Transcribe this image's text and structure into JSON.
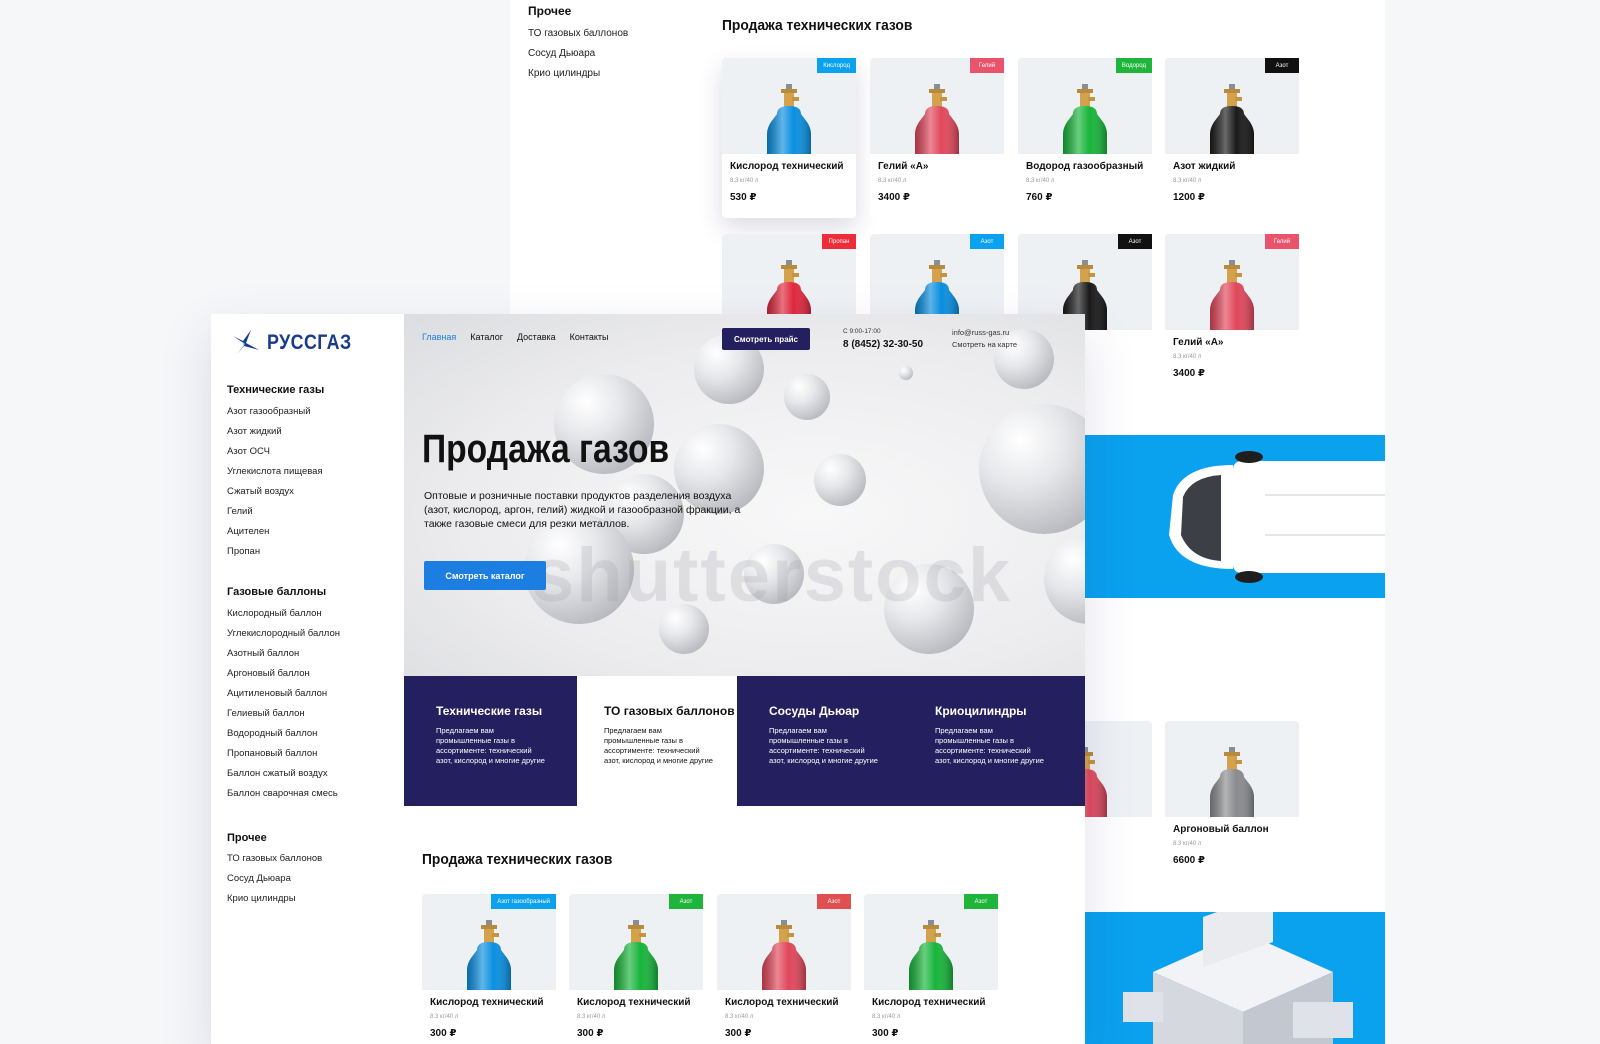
{
  "back": {
    "sidebar": {
      "other_title": "Прочее",
      "other_items": [
        "ТО газовых баллонов",
        "Сосуд Дьюара",
        "Крио цилиндры"
      ]
    },
    "section_title": "Продажа технических газов",
    "products_row1": [
      {
        "tag": "Кислород",
        "tag_color": "#0aa1ef",
        "cyl_color": "#0a8fe0",
        "name": "Кислород технический",
        "spec": "8.3 кг/40 л",
        "price": "530 ₽"
      },
      {
        "tag": "Гелий",
        "tag_color": "#e9546c",
        "cyl_color": "#e0475b",
        "name": "Гелий «А»",
        "spec": "8.3 кг/40 л",
        "price": "3400 ₽"
      },
      {
        "tag": "Водород",
        "tag_color": "#1eb53a",
        "cyl_color": "#18b43a",
        "name": "Водород газообразный",
        "spec": "8.3 кг/40 л",
        "price": "760 ₽"
      },
      {
        "tag": "Азот",
        "tag_color": "#111111",
        "cyl_color": "#1a1a1a",
        "name": "Азот жидкий",
        "spec": "8.3 кг/40 л",
        "price": "1200 ₽"
      }
    ],
    "products_row2": [
      {
        "tag": "Пропан",
        "tag_color": "#ee2d3a",
        "cyl_color": "#e2283c",
        "name": "",
        "spec": "",
        "price": ""
      },
      {
        "tag": "Азот",
        "tag_color": "#0aa1ef",
        "cyl_color": "#0a8fe0",
        "name": "",
        "spec": "",
        "price": ""
      },
      {
        "tag": "Азот",
        "tag_color": "#111111",
        "cyl_color": "#1a1a1a",
        "name": "",
        "spec": "",
        "price": ""
      },
      {
        "tag": "Гелий",
        "tag_color": "#e9546c",
        "cyl_color": "#e0475b",
        "name": "Гелий «А»",
        "spec": "8.3 кг/40 л",
        "price": "3400 ₽"
      }
    ],
    "products_row3": [
      {
        "tag": "",
        "tag_color": "",
        "cyl_color": "#e0475b",
        "name": "аллон",
        "spec": "",
        "price": ""
      },
      {
        "tag": "",
        "tag_color": "",
        "cyl_color": "#8a8b8e",
        "name": "Аргоновый баллон",
        "spec": "8.3 кг/40 л",
        "price": "6600 ₽"
      }
    ]
  },
  "front": {
    "logo_text": "РУССГАЗ",
    "sidebar": {
      "sections": [
        {
          "title": "Технические газы",
          "items": [
            "Азот газообразный",
            "Азот жидкий",
            "Азот ОСЧ",
            "Углекислота пищевая",
            "Сжатый воздух",
            "Гелий",
            "Ацителен",
            "Пропан"
          ]
        },
        {
          "title": "Газовые баллоны",
          "items": [
            "Кислородный баллон",
            "Углекислородный баллон",
            "Азотный баллон",
            "Аргоновый баллон",
            "Ацитиленовый баллон",
            "Гелиевый баллон",
            "Водородный баллон",
            "Пропановый баллон",
            "Баллон сжатый воздух",
            "Баллон сварочная смесь"
          ]
        },
        {
          "title": "Прочее",
          "items": [
            "ТО газовых баллонов",
            "Сосуд Дьюара",
            "Крио цилиндры"
          ]
        }
      ]
    },
    "nav": [
      "Главная",
      "Каталог",
      "Доставка",
      "Контакты"
    ],
    "price_button": "Смотреть прайс",
    "hours": "С 9:00-17:00",
    "phone": "8 (8452) 32-30-50",
    "email": "info@russ-gas.ru",
    "map_link": "Смотреть на карте",
    "hero": {
      "title": "Продажа газов",
      "description": "Оптовые и розничные поставки продуктов разделения воздуха (азот, кислород, аргон, гелий) жидкой и газообразной фракции, а также газовые смеси для резки металлов.",
      "button": "Смотреть каталог",
      "watermark": "shutterstock"
    },
    "tiles": [
      {
        "title": "Технические газы",
        "text": "Предлагаем вам промышленные газы в ассортименте: технический азот, кислород и многие другие"
      },
      {
        "title": "ТО газовых баллонов",
        "text": "Предлагаем вам промышленные газы в ассортименте: технический азот, кислород и многие другие"
      },
      {
        "title": "Сосуды Дьюар",
        "text": "Предлагаем вам промышленные газы в ассортименте: технический азот, кислород и многие другие"
      },
      {
        "title": "Криоцилиндры",
        "text": "Предлагаем вам промышленные газы в ассортименте: технический азот, кислород и многие другие"
      }
    ],
    "section_title": "Продажа технических газов",
    "products": [
      {
        "tag": "Азот газообразный",
        "tag_color": "#0aa1ef",
        "cyl_color": "#0a8fe0",
        "name": "Кислород технический",
        "spec": "8.3 кг/40 л",
        "price": "300 ₽"
      },
      {
        "tag": "Азот",
        "tag_color": "#1eb53a",
        "cyl_color": "#18b43a",
        "name": "Кислород технический",
        "spec": "8.3 кг/40 л",
        "price": "300 ₽"
      },
      {
        "tag": "Азот",
        "tag_color": "#e05050",
        "cyl_color": "#e0475b",
        "name": "Кислород технический",
        "spec": "8.3 кг/40 л",
        "price": "300 ₽"
      },
      {
        "tag": "Азот",
        "tag_color": "#1eb53a",
        "cyl_color": "#18b43a",
        "name": "Кислород технический",
        "spec": "8.3 кг/40 л",
        "price": "300 ₽"
      }
    ]
  },
  "colors": {
    "brand_navy": "#241f5e",
    "accent_blue": "#1c7ee0",
    "band_blue": "#0aa1ef"
  },
  "icons": {
    "logo": "star-logo-icon",
    "van": "van-illustration",
    "warehouse": "warehouse-illustration"
  }
}
